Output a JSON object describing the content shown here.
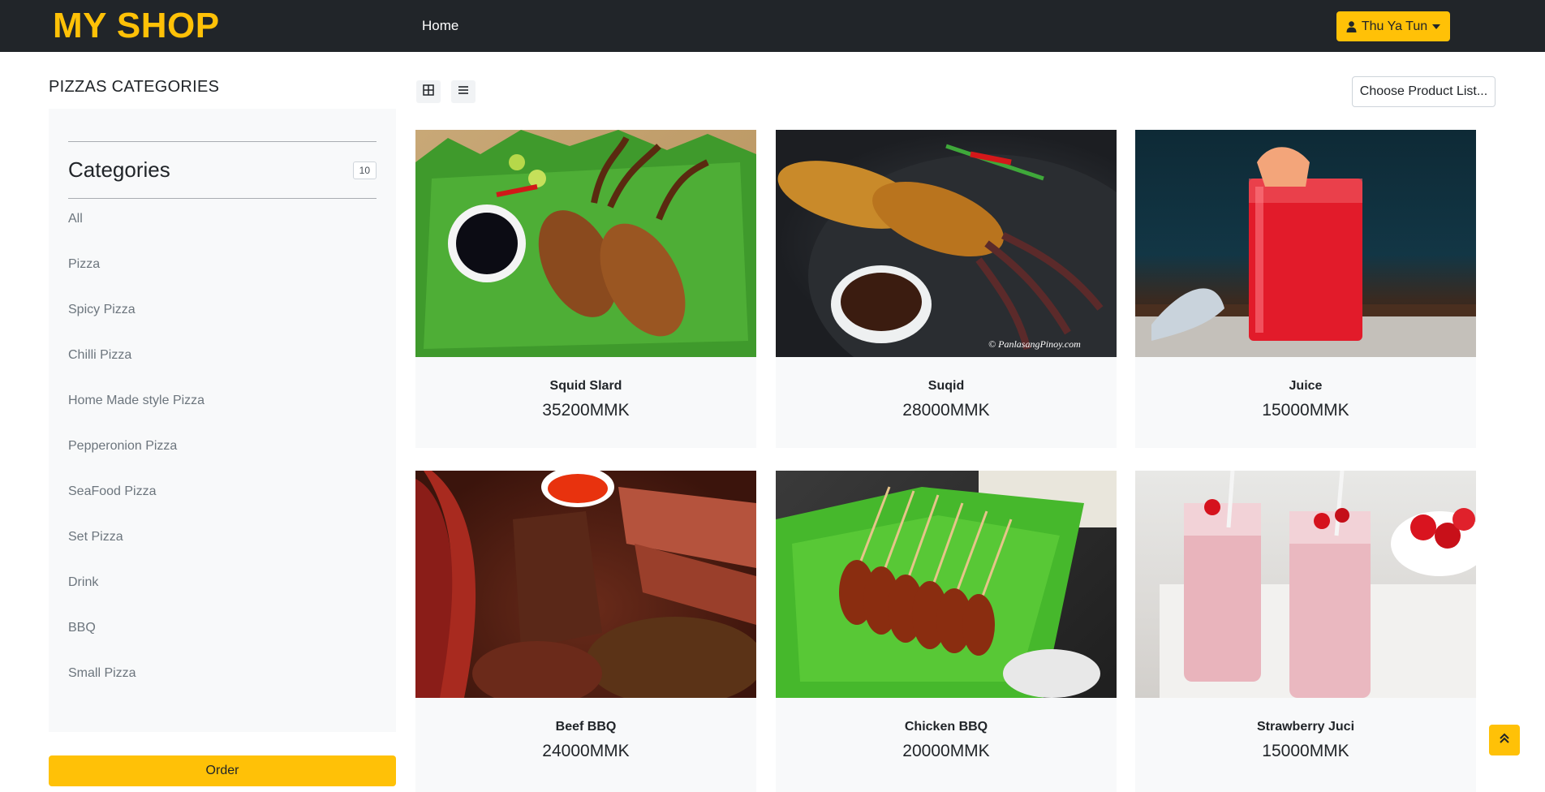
{
  "navbar": {
    "brand": "MY SHOP",
    "home_label": "Home",
    "user_name": "Thu Ya Tun"
  },
  "sidebar": {
    "title": "PIZZAS CATEGORIES",
    "heading": "Categories",
    "count": "10",
    "items": [
      {
        "label": "All"
      },
      {
        "label": "Pizza"
      },
      {
        "label": "Spicy Pizza"
      },
      {
        "label": "Chilli Pizza"
      },
      {
        "label": "Home Made style Pizza"
      },
      {
        "label": "Pepperonion Pizza"
      },
      {
        "label": "SeaFood Pizza"
      },
      {
        "label": "Set Pizza"
      },
      {
        "label": "Drink"
      },
      {
        "label": "BBQ"
      },
      {
        "label": "Small Pizza"
      }
    ],
    "order_label": "Order"
  },
  "toolbar": {
    "choose_label": "Choose Product List..."
  },
  "products": [
    {
      "name": "Squid Slard",
      "price": "35200MMK",
      "image": "grilled-squid-on-banana-leaf"
    },
    {
      "name": "Suqid",
      "price": "28000MMK",
      "image": "stuffed-squid-with-dipping-sauce",
      "watermark": "© PanlasangPinoy.com"
    },
    {
      "name": "Juice",
      "price": "15000MMK",
      "image": "red-juice-glass"
    },
    {
      "name": "Beef BBQ",
      "price": "24000MMK",
      "image": "beef-brisket-bbq-platter"
    },
    {
      "name": "Chicken BBQ",
      "price": "20000MMK",
      "image": "chicken-skewers-on-banana-leaf"
    },
    {
      "name": "Strawberry Juci",
      "price": "15000MMK",
      "image": "strawberry-milk-drinks"
    }
  ],
  "colors": {
    "navbar_bg": "#212529",
    "accent": "#ffc107",
    "panel_bg": "#f8f9fa",
    "muted_text": "#6c757d"
  },
  "icons": {
    "user": "user-icon",
    "caret": "caret-down-icon",
    "grid_view": "grid-view-icon",
    "list_view": "list-view-icon",
    "scroll_top": "double-chevron-up-icon"
  }
}
